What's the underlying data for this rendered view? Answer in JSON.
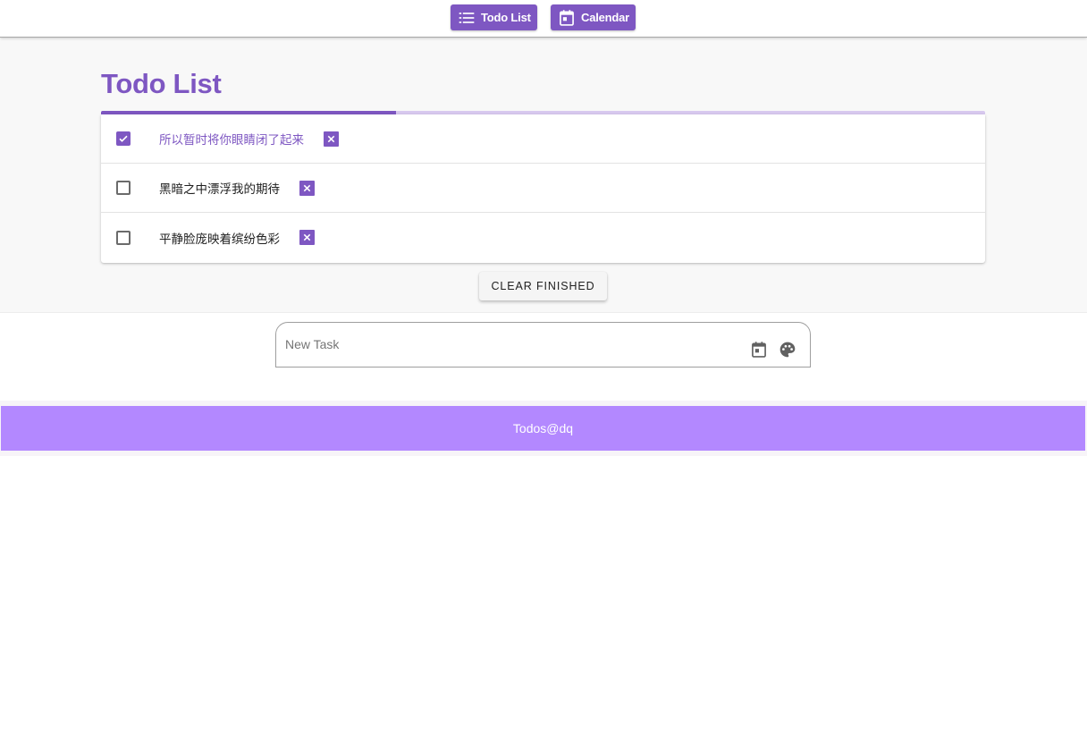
{
  "nav": {
    "todo_list_label": "Todo List",
    "calendar_label": "Calendar"
  },
  "page_title": "Todo List",
  "progress": {
    "completed_fraction": 0.3333
  },
  "todos": [
    {
      "text": "所以暂时将你眼睛闭了起来",
      "done": true
    },
    {
      "text": "黑暗之中漂浮我的期待",
      "done": false
    },
    {
      "text": "平静脸庞映着缤纷色彩",
      "done": false
    }
  ],
  "clear_finished_label": "CLEAR FINISHED",
  "new_task": {
    "placeholder": "New Task",
    "value": "",
    "icons": [
      "calendar-icon",
      "palette-icon"
    ]
  },
  "footer": {
    "text": "Todos@dq"
  },
  "colors": {
    "accent": "#7e57c2",
    "accent_light": "#d8c9ef",
    "footer": "#b388ff"
  }
}
